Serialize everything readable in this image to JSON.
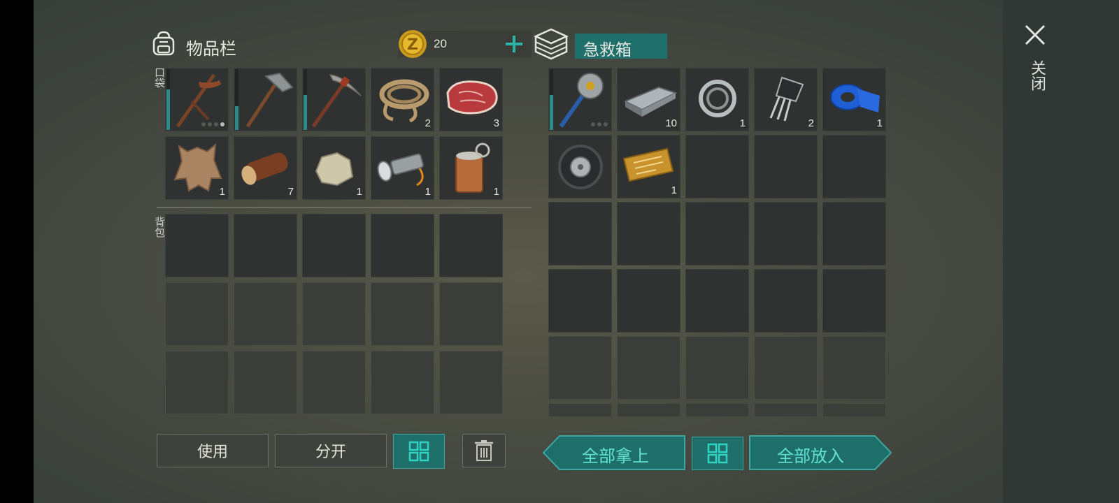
{
  "inventory": {
    "title": "物品栏",
    "coin_count": "20",
    "pocket_label": "口袋",
    "backpack_label": "背包",
    "pocket_items": [
      {
        "name": "crossbow-pickaxe",
        "qty": ""
      },
      {
        "name": "stone-hammer",
        "qty": ""
      },
      {
        "name": "pickaxe",
        "qty": ""
      },
      {
        "name": "rope",
        "qty": "2"
      },
      {
        "name": "raw-meat",
        "qty": "3"
      },
      {
        "name": "animal-hide",
        "qty": "1"
      },
      {
        "name": "wood-log",
        "qty": "7"
      },
      {
        "name": "stone",
        "qty": "1"
      },
      {
        "name": "flashlight",
        "qty": "1"
      },
      {
        "name": "canned-food",
        "qty": "1"
      }
    ],
    "buttons": {
      "use": "使用",
      "split": "分开"
    }
  },
  "container": {
    "title": "急救箱",
    "items": [
      {
        "name": "saw-mace",
        "qty": ""
      },
      {
        "name": "iron-bar",
        "qty": "10"
      },
      {
        "name": "bearing",
        "qty": "1"
      },
      {
        "name": "transistor",
        "qty": "2"
      },
      {
        "name": "blue-tape",
        "qty": "1"
      },
      {
        "name": "tire",
        "qty": ""
      },
      {
        "name": "survival-coupon",
        "qty": "1"
      }
    ],
    "buttons": {
      "take_all": "全部拿上",
      "put_all": "全部放入"
    }
  },
  "close_label": "关闭",
  "colors": {
    "accent": "#2aa39a",
    "button_teal": "#1e6e6a",
    "slot": "#2f3230"
  }
}
